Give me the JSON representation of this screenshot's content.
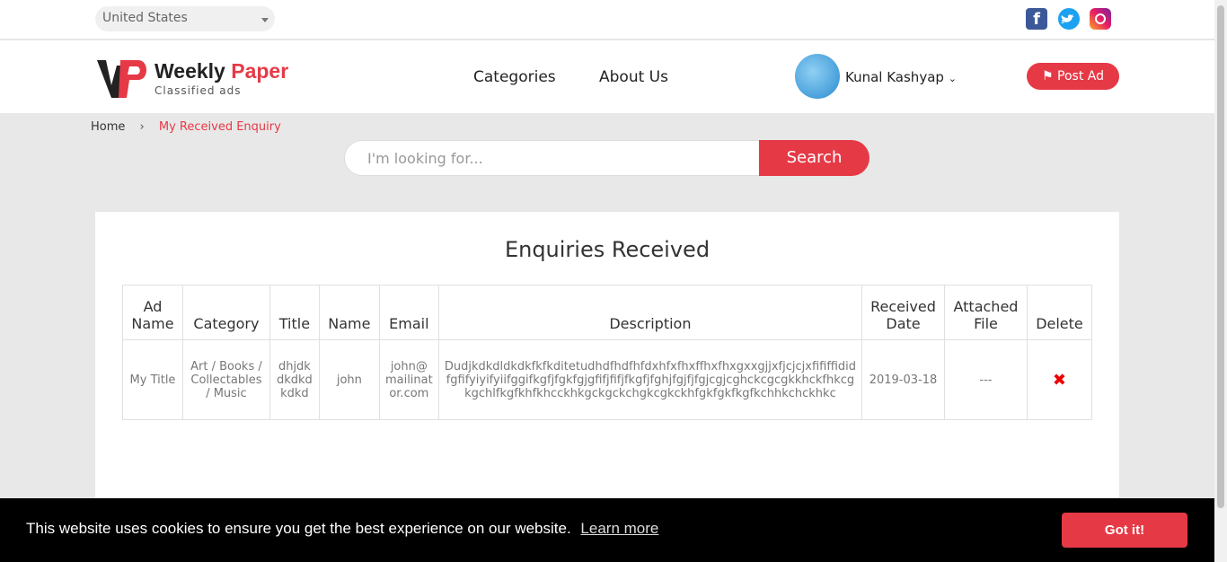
{
  "topbar": {
    "country": "United States",
    "social_icons": [
      "facebook-icon",
      "twitter-icon",
      "instagram-icon"
    ]
  },
  "header": {
    "logo": {
      "name_a": "Weekly",
      "name_b": "Paper",
      "tagline": "Classified ads"
    },
    "nav": [
      "Categories",
      "About Us"
    ],
    "user": {
      "name": "Kunal Kashyap"
    },
    "post_ad": "Post Ad"
  },
  "breadcrumb": {
    "home": "Home",
    "current": "My Received Enquiry"
  },
  "search": {
    "placeholder": "I'm looking for...",
    "button": "Search"
  },
  "main": {
    "title": "Enquiries Received",
    "columns": [
      "Ad Name",
      "Category",
      "Title",
      "Name",
      "Email",
      "Description",
      "Received Date",
      "Attached File",
      "Delete"
    ],
    "rows": [
      {
        "ad_name": "My Title",
        "category": "Art / Books / Collectables / Music",
        "title": "dhjdkdkdkdkdkd",
        "name": "john",
        "email": "john@mailinator.com",
        "description": "Dudjkdkdldkdkfkfkditetudhdfhdfhfdxhfxfhxffhxfhxgxxgjjxfjcjcjxfififfididfgfifyiyifyiifggifkgfjfgkfgjgfifjfifjfkgfjfghjfgjfjfgjcgjcghckcgcgkkhckfhkcgkgchlfkgfkhfkhcckhkgckgckchgkcgkckhfgkfgkfkgfkchhkchckhkc",
        "received_date": "2019-03-18",
        "attached_file": "---",
        "delete": "✖"
      }
    ]
  },
  "cookie": {
    "text": "This website uses cookies to ensure you get the best experience on our website.",
    "learn_more": "Learn more",
    "button": "Got it!"
  },
  "colors": {
    "accent": "#e63946",
    "link": "#3a7bd5"
  }
}
